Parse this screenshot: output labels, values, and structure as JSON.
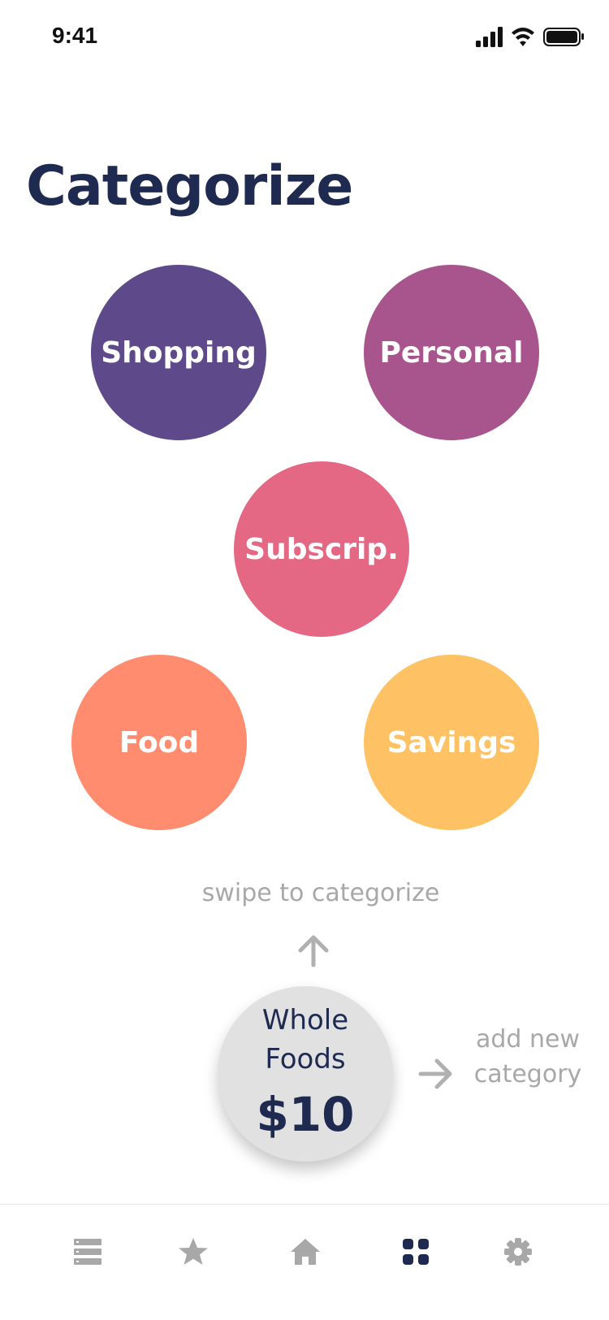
{
  "status_bar": {
    "time": "9:41"
  },
  "header": {
    "title": "Categorize"
  },
  "categories": [
    {
      "label": "Shopping",
      "color": "#5e4a8a"
    },
    {
      "label": "Personal",
      "color": "#a8558e"
    },
    {
      "label": "Subscrip.",
      "color": "#e46883"
    },
    {
      "label": "Food",
      "color": "#ff8c6e"
    },
    {
      "label": "Savings",
      "color": "#fec264"
    }
  ],
  "hint": "swipe to categorize",
  "transaction": {
    "merchant": "Whole Foods",
    "amount": "$10"
  },
  "add_category": {
    "label": "add new category"
  },
  "tab_bar": {
    "active_color": "#1e2a4f",
    "inactive_color": "#a8a8a8",
    "tabs": [
      {
        "icon": "list-icon"
      },
      {
        "icon": "star-icon"
      },
      {
        "icon": "home-icon"
      },
      {
        "icon": "grid-icon",
        "active": true
      },
      {
        "icon": "gear-icon"
      }
    ]
  }
}
